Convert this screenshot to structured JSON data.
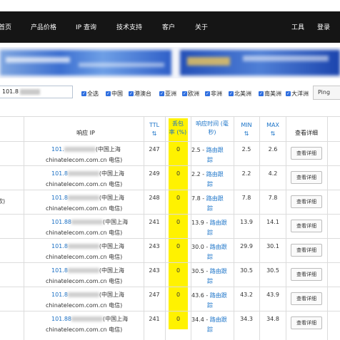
{
  "nav": {
    "left": [
      "首页",
      "产品价格",
      "IP 查询",
      "技术支持",
      "客户",
      "关于"
    ],
    "right": [
      "工具",
      "登录"
    ]
  },
  "search": {
    "ip_value": "101.8",
    "options": [
      "全选",
      "中国",
      "港澳台",
      "亚洲",
      "欧洲",
      "非洲",
      "北美洲",
      "南美洲",
      "大洋洲"
    ],
    "ping_label": "Ping"
  },
  "table": {
    "headers": {
      "ip": "响应 IP",
      "ttl": "TTL",
      "loss_1": "丢包",
      "loss_2": "率 (%)",
      "resp_1": "响应时间 (毫",
      "resp_2": "秒)",
      "min": "MIN",
      "max": "MAX",
      "detail": "查看详细"
    },
    "rows": [
      {
        "ip": "101.",
        "loc": "(中国上海",
        "isp": "chinatelecom.com.cn 电信)",
        "ttl": "247",
        "loss": "0",
        "resp": "2.5",
        "route1": "路由跟",
        "route2": "踪",
        "min": "2.5",
        "max": "2.6",
        "detail": "查看详细",
        "left": ""
      },
      {
        "ip": "101.8",
        "loc": "(中国上海",
        "isp": "chinatelecom.com.cn 电信)",
        "ttl": "249",
        "loss": "0",
        "resp": "2.2",
        "route1": "路由跟",
        "route2": "踪",
        "min": "2.2",
        "max": "4.2",
        "detail": "查看详细",
        "left": ""
      },
      {
        "ip": "101.8",
        "loc": "(中国上海",
        "isp": "chinatelecom.com.cn 电信)",
        "ttl": "248",
        "loss": "0",
        "resp": "7.8",
        "route1": "路由跟",
        "route2": "踪",
        "min": "7.8",
        "max": "7.8",
        "detail": "查看详细",
        "left": "欧)"
      },
      {
        "ip": "101.88",
        "loc": "(中国上海",
        "isp": "chinatelecom.com.cn 电信)",
        "ttl": "241",
        "loss": "0",
        "resp": "13.9",
        "route1": "路由跟",
        "route2": "踪",
        "min": "13.9",
        "max": "14.1",
        "detail": "查看详细",
        "left": ""
      },
      {
        "ip": "101.8",
        "loc": "(中国上海",
        "isp": "chinatelecom.com.cn 电信)",
        "ttl": "243",
        "loss": "0",
        "resp": "30.0",
        "route1": "路由跟",
        "route2": "踪",
        "min": "29.9",
        "max": "30.1",
        "detail": "查看详细",
        "left": ""
      },
      {
        "ip": "101.8",
        "loc": "(中国上海",
        "isp": "chinatelecom.com.cn 电信)",
        "ttl": "243",
        "loss": "0",
        "resp": "30.5",
        "route1": "路由跟",
        "route2": "踪",
        "min": "30.5",
        "max": "30.5",
        "detail": "查看详细",
        "left": ""
      },
      {
        "ip": "101.8",
        "loc": "(中国上海",
        "isp": "chinatelecom.com.cn 电信)",
        "ttl": "247",
        "loss": "0",
        "resp": "43.6",
        "route1": "路由跟",
        "route2": "踪",
        "min": "43.2",
        "max": "43.9",
        "detail": "查看详细",
        "left": ""
      },
      {
        "ip": "101.88",
        "loc": "(中国上海",
        "isp": "chinatelecom.com.cn 电信)",
        "ttl": "241",
        "loss": "0",
        "resp": "34.4",
        "route1": "路由跟",
        "route2": "踪",
        "min": "34.3",
        "max": "34.8",
        "detail": "查看详细",
        "left": ""
      }
    ]
  },
  "colors": {
    "nav_bg": "#151515",
    "link_blue": "#1a73c8",
    "loss_highlight": "#fff200",
    "checkbox_blue": "#2f6fe0"
  }
}
